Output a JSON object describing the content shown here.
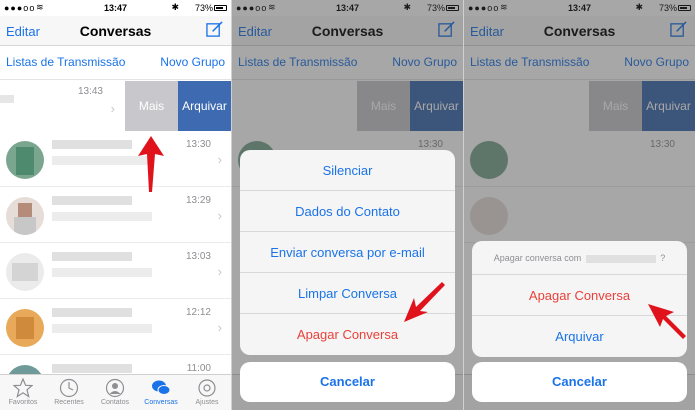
{
  "status": {
    "carrier": "●●●oo",
    "time": "13:47",
    "battery": "73%"
  },
  "navbar": {
    "edit": "Editar",
    "title": "Conversas"
  },
  "lists": {
    "broadcast": "Listas de Transmissão",
    "new_group": "Novo Grupo"
  },
  "swipe": {
    "time": "13:43",
    "more": "Mais",
    "archive": "Arquivar"
  },
  "chats": [
    {
      "time": "13:30"
    },
    {
      "time": "13:29"
    },
    {
      "time": "13:03"
    },
    {
      "time": "12:12"
    },
    {
      "time": "11:00"
    }
  ],
  "tabs": [
    {
      "label": "Favoritos",
      "icon": "star-icon"
    },
    {
      "label": "Recentes",
      "icon": "clock-icon"
    },
    {
      "label": "Contatos",
      "icon": "person-icon"
    },
    {
      "label": "Conversas",
      "icon": "chat-bubbles-icon",
      "active": true
    },
    {
      "label": "Ajustes",
      "icon": "gear-icon"
    }
  ],
  "sheet_options": {
    "silence": "Silenciar",
    "contact_info": "Dados do Contato",
    "email_chat": "Enviar conversa por e-mail",
    "clear_chat": "Limpar Conversa",
    "delete_chat": "Apagar Conversa",
    "cancel": "Cancelar"
  },
  "confirm_sheet": {
    "prompt_prefix": "Apagar conversa com",
    "prompt_suffix": "?",
    "delete_chat": "Apagar Conversa",
    "archive": "Arquivar",
    "cancel": "Cancelar"
  },
  "colors": {
    "accent": "#1a73e8",
    "destructive": "#e8413b",
    "archive": "#3d6ab0",
    "more": "#c7c7cc",
    "arrow": "#e0131c"
  }
}
